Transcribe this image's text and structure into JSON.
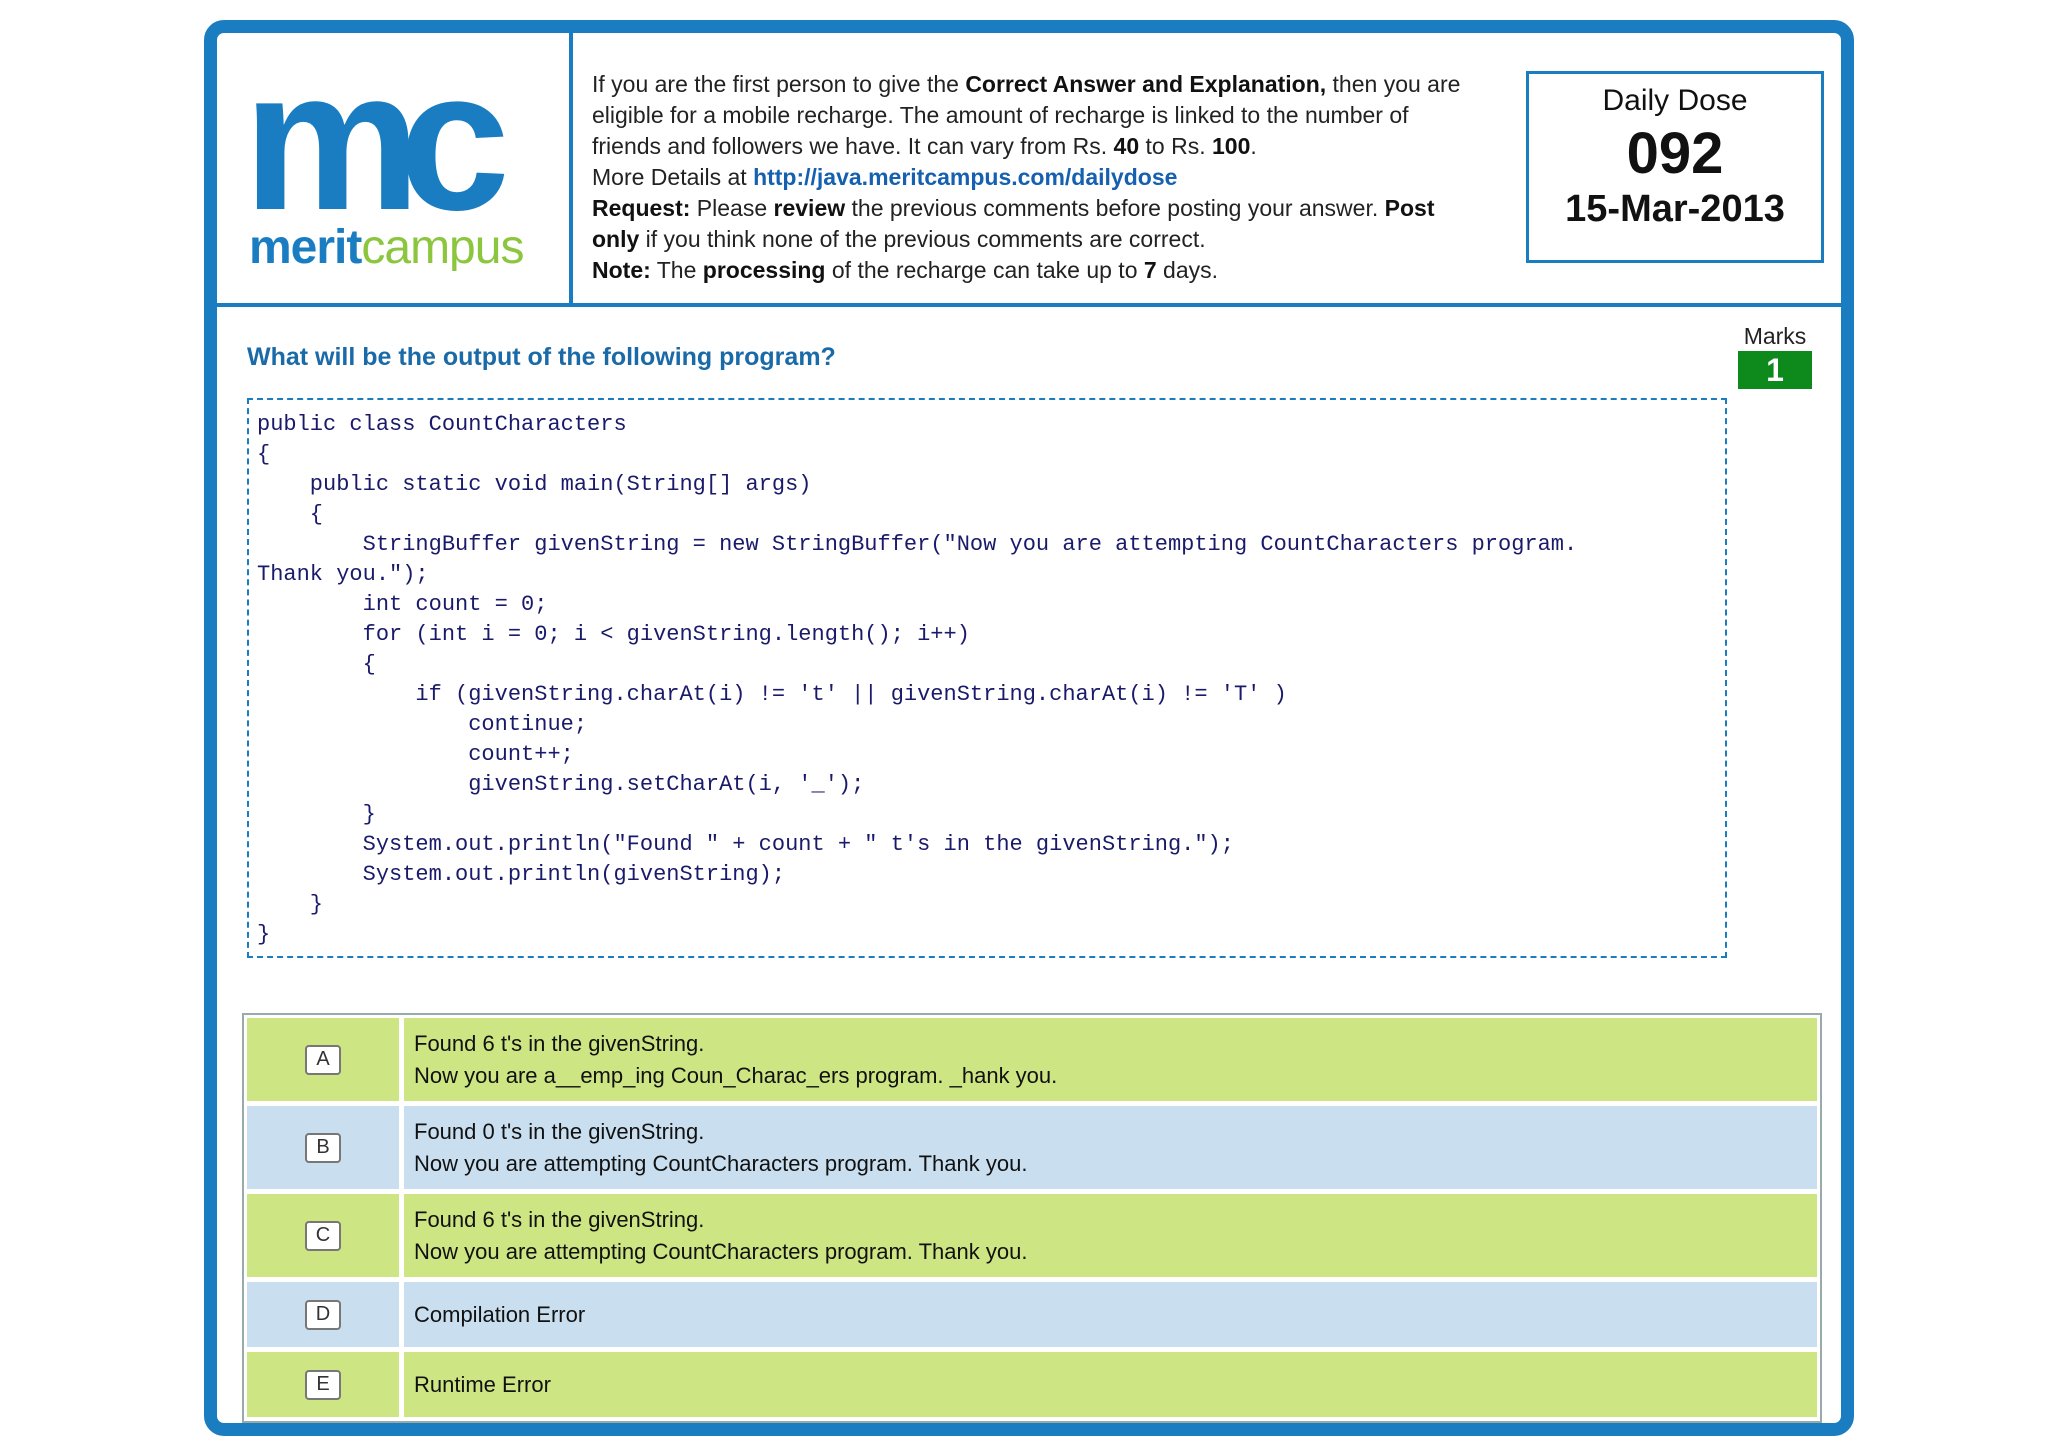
{
  "brand": {
    "logo_letters": "mc",
    "name_part1": "merit",
    "name_part2": "campus",
    "color_blue": "#1a7dc1",
    "color_green": "#8cc63f"
  },
  "info": {
    "l1_a": "If you are the first person to give the ",
    "l1_b": "Correct Answer and Explanation,",
    "l1_c": " then you are",
    "l2": "eligible for a mobile recharge. The amount of recharge is linked to the number of",
    "l3_a": "friends and followers we have. It can vary from Rs. ",
    "l3_b": "40",
    "l3_c": " to Rs. ",
    "l3_d": "100",
    "l3_e": ".",
    "l4_a": "More Details at ",
    "l4_link": "http://java.meritcampus.com/dailydose",
    "l5_a": "Request:",
    "l5_b": " Please ",
    "l5_c": "review",
    "l5_d": " the previous comments before posting your answer. ",
    "l5_e": "Post",
    "l6_a": "only",
    "l6_b": " if you think none of the previous comments are correct.",
    "l7_a": "Note:",
    "l7_b": " The ",
    "l7_c": "processing",
    "l7_d": " of the recharge can take up to ",
    "l7_e": "7",
    "l7_f": " days."
  },
  "daily_dose": {
    "title": "Daily Dose",
    "number": "092",
    "date": "15-Mar-2013"
  },
  "question": {
    "text": "What will be the output of the following program?",
    "marks_label": "Marks",
    "marks_value": "1"
  },
  "code": "public class CountCharacters\n{\n    public static void main(String[] args)\n    {\n        StringBuffer givenString = new StringBuffer(\"Now you are attempting CountCharacters program.\nThank you.\");\n        int count = 0;\n        for (int i = 0; i < givenString.length(); i++)\n        {\n            if (givenString.charAt(i) != 't' || givenString.charAt(i) != 'T' )\n                continue;\n                count++;\n                givenString.setCharAt(i, '_');\n        }\n        System.out.println(\"Found \" + count + \" t's in the givenString.\");\n        System.out.println(givenString);\n    }\n}",
  "options": [
    {
      "letter": "A",
      "line1": "Found 6 t's in the givenString.",
      "line2": "Now you are a__emp_ing Coun_Charac_ers program. _hank you."
    },
    {
      "letter": "B",
      "line1": "Found 0 t's in the givenString.",
      "line2": "Now you are attempting CountCharacters program. Thank you."
    },
    {
      "letter": "C",
      "line1": "Found 6 t's in the givenString.",
      "line2": "Now you are attempting CountCharacters program. Thank you."
    },
    {
      "letter": "D",
      "line1": "Compilation Error",
      "line2": ""
    },
    {
      "letter": "E",
      "line1": "Runtime Error",
      "line2": ""
    }
  ]
}
